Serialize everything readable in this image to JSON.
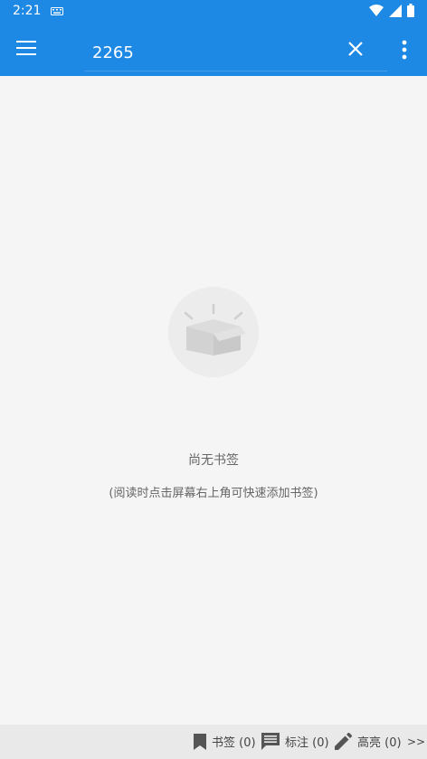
{
  "status_bar": {
    "time": "2:21"
  },
  "app_bar": {
    "search_value": "2265"
  },
  "empty_state": {
    "title": "尚无书签",
    "hint": "(阅读时点击屏幕右上角可快速添加书签)"
  },
  "bottom_bar": {
    "bookmarks_label": "书签 (0)",
    "notes_label": "标注 (0)",
    "highlights_label": "高亮 (0)",
    "more_label": ">>"
  },
  "colors": {
    "primary": "#1e88e5",
    "background": "#f5f5f5",
    "bottom_bar": "#e9e9e9"
  },
  "icons": [
    "keyboard-icon",
    "wifi-icon",
    "signal-icon",
    "battery-icon",
    "menu-icon",
    "close-icon",
    "more-vert-icon",
    "empty-box-icon",
    "bookmark-icon",
    "comment-icon",
    "pencil-icon"
  ]
}
